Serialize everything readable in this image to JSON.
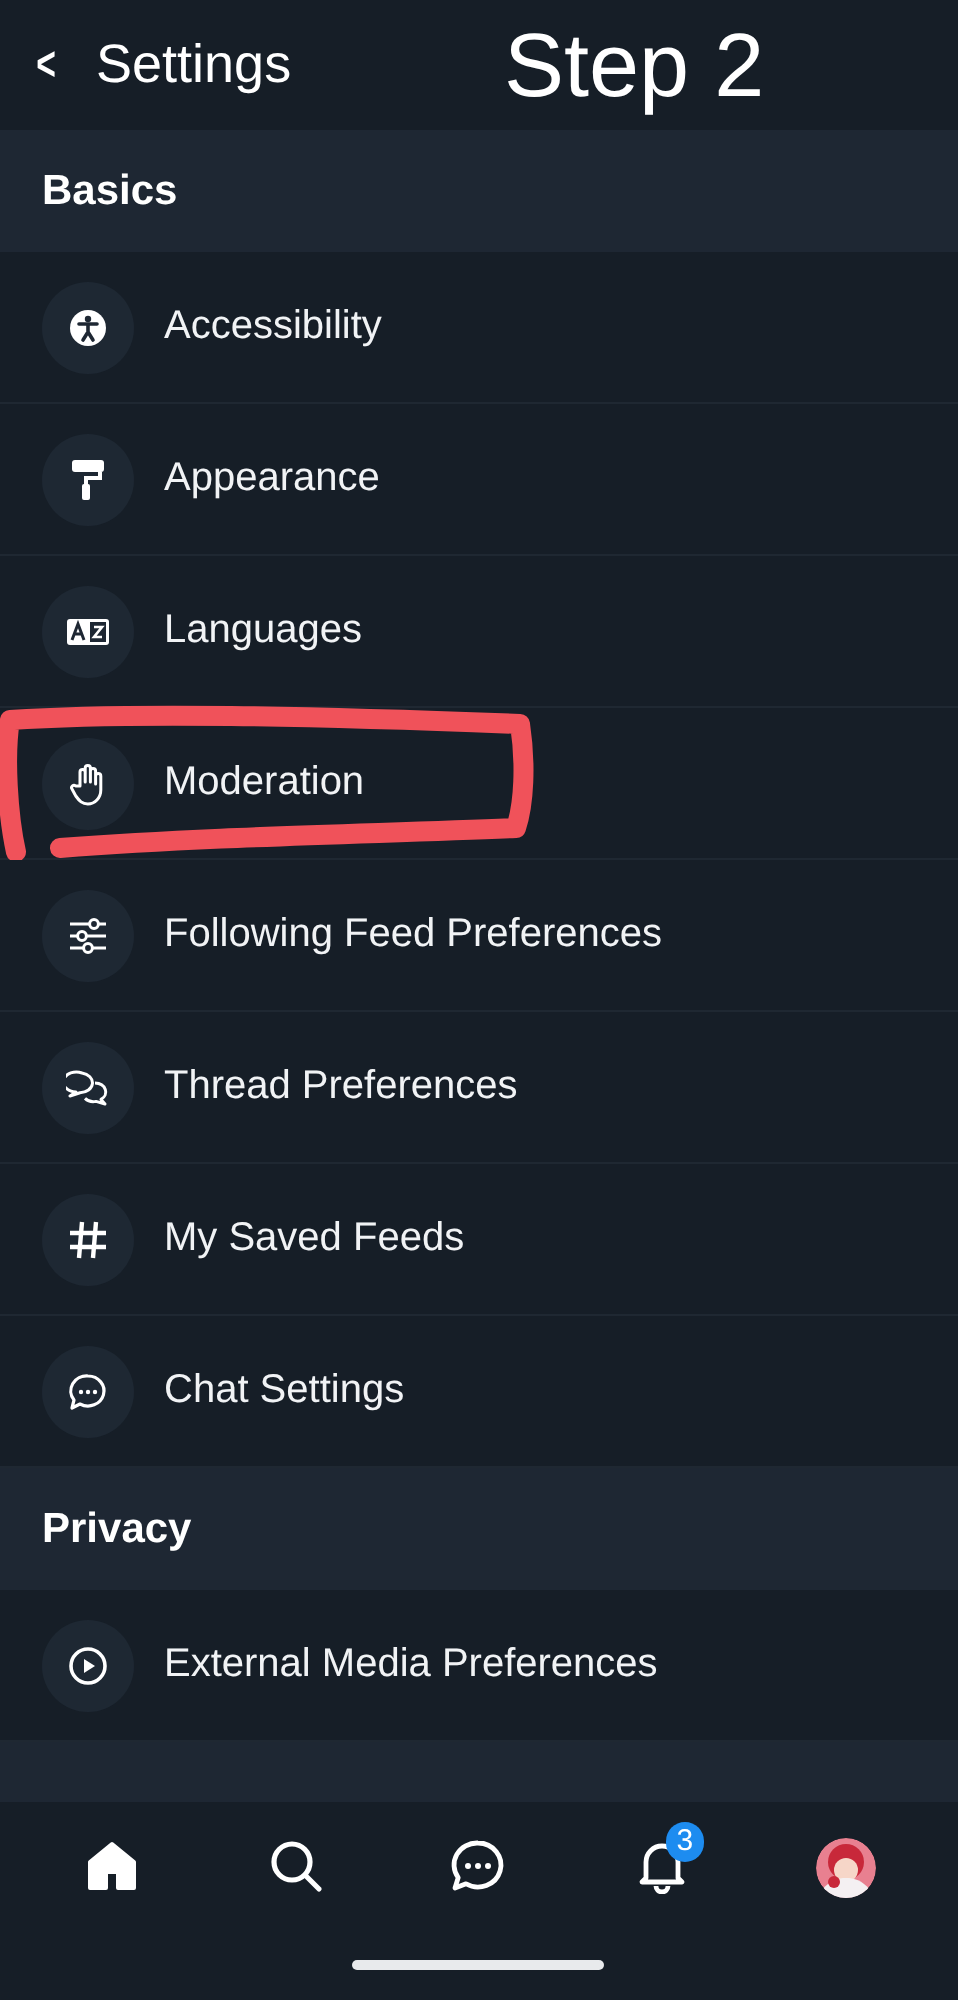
{
  "header": {
    "back": "<",
    "title": "Settings",
    "annotation": "Step 2"
  },
  "sections": [
    {
      "title": "Basics",
      "items": [
        {
          "label": "Accessibility"
        },
        {
          "label": "Appearance"
        },
        {
          "label": "Languages"
        },
        {
          "label": "Moderation",
          "highlighted": true
        },
        {
          "label": "Following Feed Preferences"
        },
        {
          "label": "Thread Preferences"
        },
        {
          "label": "My Saved Feeds"
        },
        {
          "label": "Chat Settings"
        }
      ]
    },
    {
      "title": "Privacy",
      "items": [
        {
          "label": "External Media Preferences"
        }
      ]
    }
  ],
  "nav": [
    {
      "selected": true
    },
    {
      "selected": false
    },
    {
      "selected": false
    },
    {
      "selected": false,
      "badge": "3"
    },
    {
      "selected": false,
      "kind": "avatar"
    }
  ]
}
